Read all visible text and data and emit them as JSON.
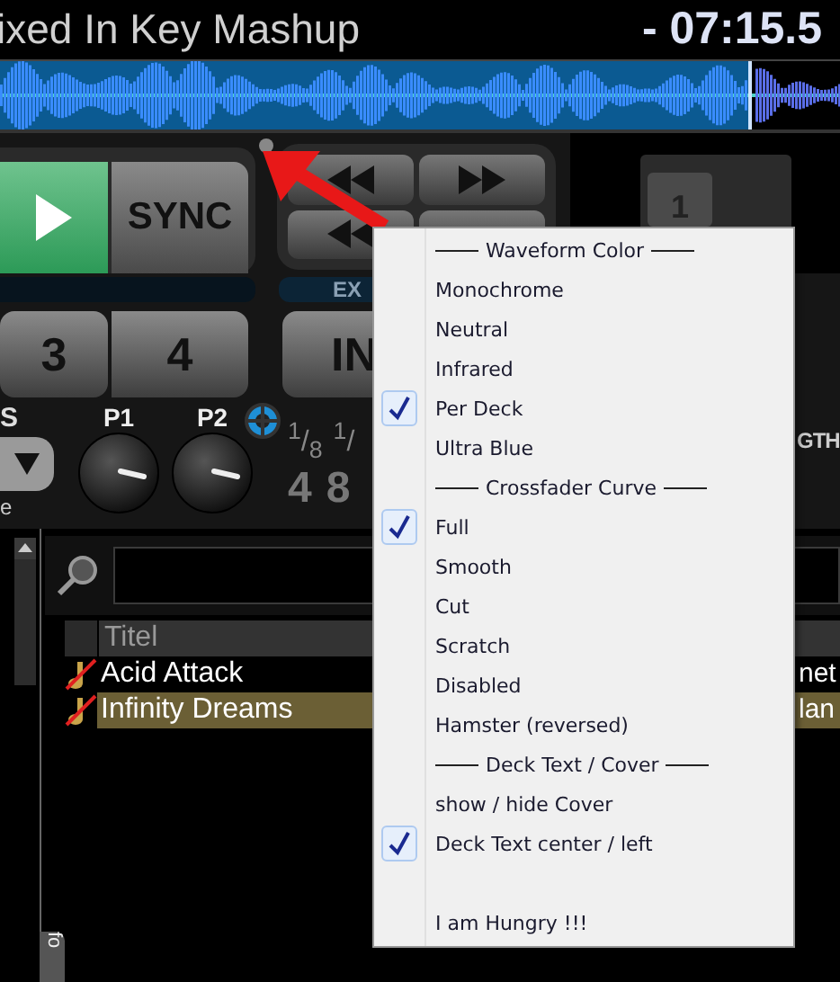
{
  "title_bar": {
    "title": "ixed In Key Mashup",
    "time": "- 07:15.5"
  },
  "deck": {
    "sync": "SYNC",
    "loop_label": "EX",
    "sampler_slot": "1",
    "hotcues": [
      "3",
      "4",
      "IN"
    ],
    "mode_label": "S",
    "mode_caption": "e",
    "knobs": [
      {
        "label": "P1"
      },
      {
        "label": "P2"
      }
    ],
    "beat_fractions": [
      "$^{1}$/$_{8}$",
      "$^{1}$/"
    ],
    "beat_numbers": [
      "4",
      "8"
    ],
    "length_label": "GTH"
  },
  "browser": {
    "columns": [
      "Titel"
    ],
    "rows": [
      {
        "title": "Acid Attack",
        "column_2": "net",
        "selected": false
      },
      {
        "title": "Infinity Dreams",
        "column_2": "lan",
        "selected": true
      }
    ],
    "side_tab": "fo"
  },
  "context_menu": {
    "items": [
      {
        "kind": "header",
        "label": "Waveform Color"
      },
      {
        "kind": "item",
        "label": "Monochrome",
        "checked": false
      },
      {
        "kind": "item",
        "label": "Neutral",
        "checked": false
      },
      {
        "kind": "item",
        "label": "Infrared",
        "checked": false
      },
      {
        "kind": "item",
        "label": "Per Deck",
        "checked": true
      },
      {
        "kind": "item",
        "label": "Ultra Blue",
        "checked": false
      },
      {
        "kind": "header",
        "label": "Crossfader Curve"
      },
      {
        "kind": "item",
        "label": "Full",
        "checked": true
      },
      {
        "kind": "item",
        "label": "Smooth",
        "checked": false
      },
      {
        "kind": "item",
        "label": "Cut",
        "checked": false
      },
      {
        "kind": "item",
        "label": "Scratch",
        "checked": false
      },
      {
        "kind": "item",
        "label": "Disabled",
        "checked": false
      },
      {
        "kind": "item",
        "label": "Hamster (reversed)",
        "checked": false
      },
      {
        "kind": "header",
        "label": "Deck Text / Cover"
      },
      {
        "kind": "item",
        "label": "show / hide Cover",
        "checked": false
      },
      {
        "kind": "item",
        "label": "Deck Text center / left",
        "checked": true
      },
      {
        "kind": "gap"
      },
      {
        "kind": "item",
        "label": "I am Hungry !!!",
        "checked": false
      }
    ]
  }
}
